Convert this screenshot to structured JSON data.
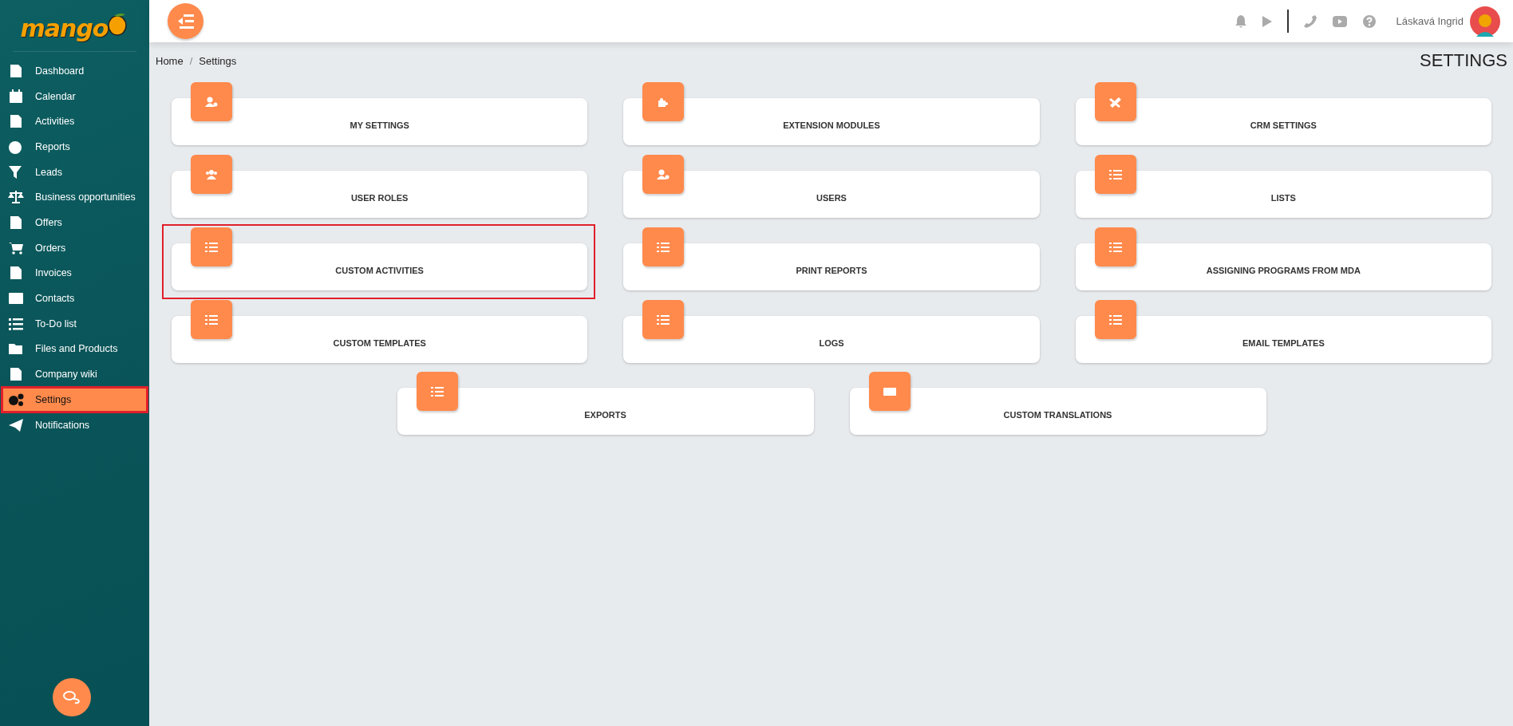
{
  "sidebar": {
    "logo": "mango",
    "items": [
      {
        "label": "Dashboard",
        "selected": false,
        "highlighted": false
      },
      {
        "label": "Calendar",
        "selected": false,
        "highlighted": false
      },
      {
        "label": "Activities",
        "selected": false,
        "highlighted": false
      },
      {
        "label": "Reports",
        "selected": false,
        "highlighted": false
      },
      {
        "label": "Leads",
        "selected": false,
        "highlighted": false
      },
      {
        "label": "Business opportunities",
        "selected": false,
        "highlighted": false
      },
      {
        "label": "Offers",
        "selected": false,
        "highlighted": false
      },
      {
        "label": "Orders",
        "selected": false,
        "highlighted": false
      },
      {
        "label": "Invoices",
        "selected": false,
        "highlighted": false
      },
      {
        "label": "Contacts",
        "selected": false,
        "highlighted": false
      },
      {
        "label": "To-Do list",
        "selected": false,
        "highlighted": false
      },
      {
        "label": "Files and Products",
        "selected": false,
        "highlighted": false
      },
      {
        "label": "Company wiki",
        "selected": false,
        "highlighted": false
      },
      {
        "label": "Settings",
        "selected": true,
        "highlighted": true
      },
      {
        "label": "Notifications",
        "selected": false,
        "highlighted": false
      }
    ]
  },
  "top_bar": {
    "user_name": "Láskavá Ingrid"
  },
  "breadcrumb": {
    "items": [
      "Home",
      "Settings"
    ],
    "separator": "/"
  },
  "page_title": "SETTINGS",
  "cards": [
    {
      "label": "MY SETTINGS",
      "highlighted": false
    },
    {
      "label": "EXTENSION MODULES",
      "highlighted": false
    },
    {
      "label": "CRM SETTINGS",
      "highlighted": false
    },
    {
      "label": "USER ROLES",
      "highlighted": false
    },
    {
      "label": "USERS",
      "highlighted": false
    },
    {
      "label": "LISTS",
      "highlighted": false
    },
    {
      "label": "CUSTOM ACTIVITIES",
      "highlighted": true
    },
    {
      "label": "PRINT REPORTS",
      "highlighted": false
    },
    {
      "label": "ASSIGNING PROGRAMS FROM MDA",
      "highlighted": false
    },
    {
      "label": "CUSTOM TEMPLATES",
      "highlighted": false
    },
    {
      "label": "LOGS",
      "highlighted": false
    },
    {
      "label": "EMAIL TEMPLATES",
      "highlighted": false
    },
    {
      "label": "EXPORTS",
      "highlighted": false
    },
    {
      "label": "CUSTOM TRANSLATIONS",
      "highlighted": false
    }
  ]
}
